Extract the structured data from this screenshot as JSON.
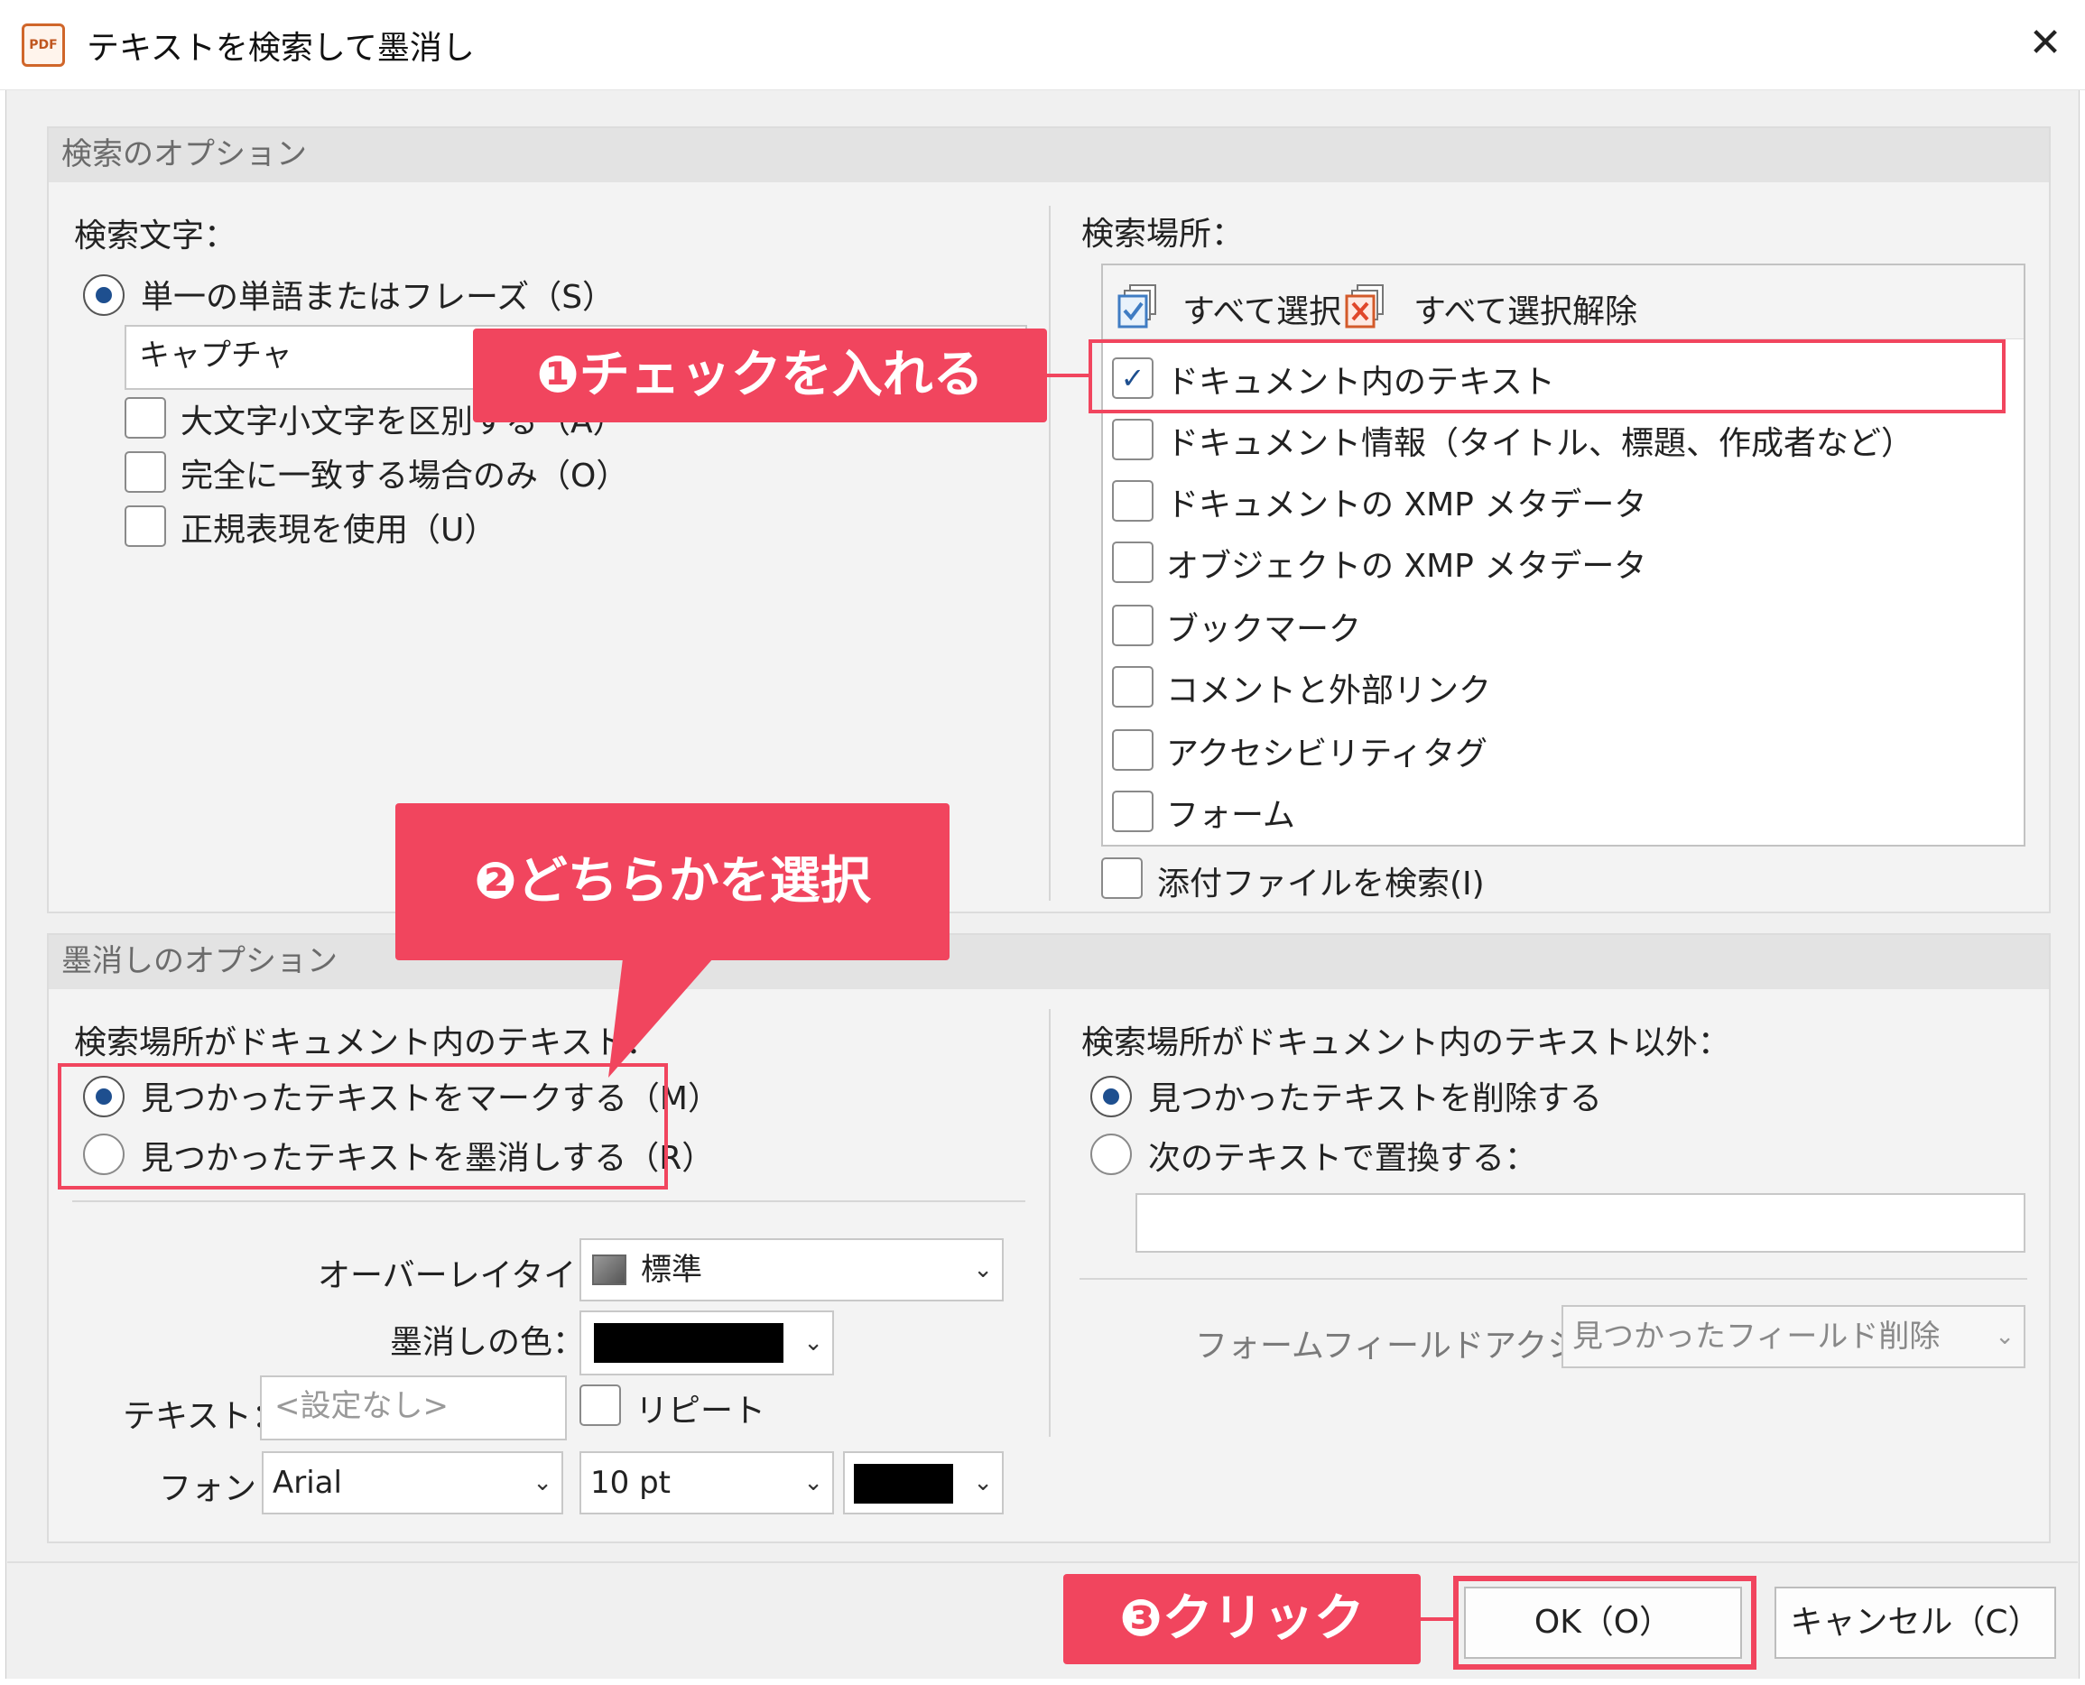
{
  "window": {
    "title": "テキストを検索して墨消し",
    "icon_text": "PDF",
    "close_glyph": "✕"
  },
  "search_options": {
    "header": "検索のオプション",
    "search_text_label": "検索文字：",
    "single_word_label": "単一の単語またはフレーズ（S）",
    "search_value": "キャプチャ",
    "options": [
      {
        "label": "大文字小文字を区別する（A）",
        "checked": false
      },
      {
        "label": "完全に一致する場合のみ（O）",
        "checked": false
      },
      {
        "label": "正規表現を使用（U）",
        "checked": false
      }
    ],
    "location_label": "検索場所：",
    "select_all": "すべて選択",
    "deselect_all": "すべて選択解除",
    "locations": [
      {
        "label": "ドキュメント内のテキスト",
        "checked": true
      },
      {
        "label": "ドキュメント情報（タイトル、標題、作成者など）",
        "checked": false
      },
      {
        "label": "ドキュメントの XMP メタデータ",
        "checked": false
      },
      {
        "label": "オブジェクトの XMP メタデータ",
        "checked": false
      },
      {
        "label": "ブックマーク",
        "checked": false
      },
      {
        "label": "コメントと外部リンク",
        "checked": false
      },
      {
        "label": "アクセシビリティタグ",
        "checked": false
      },
      {
        "label": "フォーム",
        "checked": false
      }
    ],
    "attachments_label": "添付ファイルを検索(I)"
  },
  "redaction_options": {
    "header": "墨消しのオプション",
    "in_text_label": "検索場所がドキュメント内のテキスト：",
    "mark_label": "見つかったテキストをマークする（M）",
    "redact_label": "見つかったテキストを墨消しする（R）",
    "overlay_type_label": "オーバーレイタイプ：",
    "overlay_type_value": "標準",
    "color_label": "墨消しの色：",
    "color_value": "#000000",
    "text_label": "テキスト：",
    "text_placeholder": "<設定なし>",
    "repeat_label": "リピート",
    "font_label": "フォント",
    "font_value": "Arial",
    "size_value": "10 pt",
    "font_color": "#000000",
    "other_label": "検索場所がドキュメント内のテキスト以外：",
    "delete_label": "見つかったテキストを削除する",
    "replace_label": "次のテキストで置換する：",
    "replace_value": "",
    "form_field_label": "フォームフィールドアクション：",
    "form_field_value": "見つかったフィールド削除"
  },
  "buttons": {
    "ok": "OK（O）",
    "cancel": "キャンセル（C）"
  },
  "annotations": {
    "step1": "❶チェックを入れる",
    "step2": "❷どちらかを選択",
    "step3": "❸クリック",
    "color": "#f1455e"
  }
}
